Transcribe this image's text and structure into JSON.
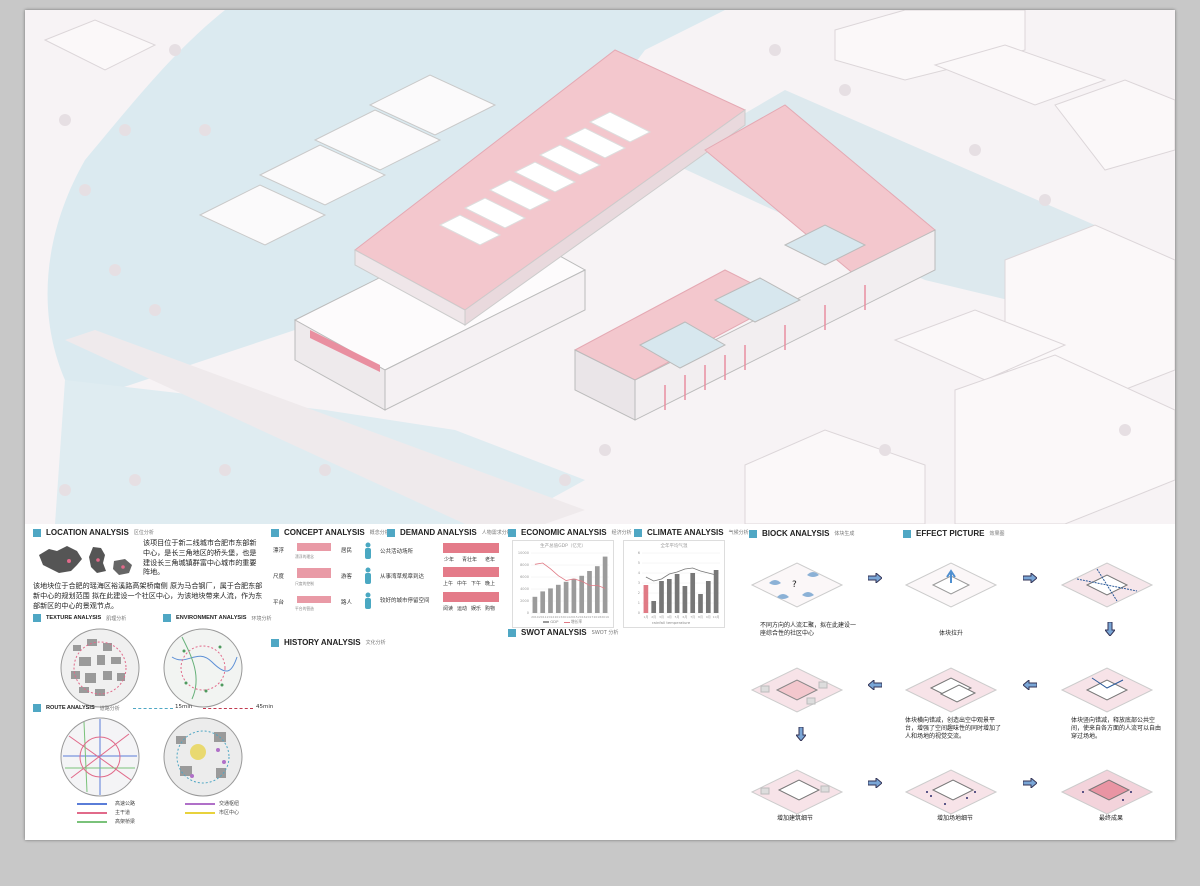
{
  "hero": {
    "palette": {
      "water": "#d7e8ee",
      "roof": "#f1c6cc",
      "roof_edge": "#e7a5b0",
      "ground": "#f8f2f4",
      "building": "#fbf8f9"
    }
  },
  "location": {
    "title": "LOCATION ANALYSIS",
    "title_cn": "区位分析",
    "paragraph_1": "该项目位于新二线城市合肥市东部新中心，是长三角地区的桥头堡，也是建设长三角城镇群富中心城市的重要阵地。",
    "paragraph_2": "该地块位于合肥的瑶海区裕溪路高架桥南侧 原为马合钢厂，属于合肥东部新中心的规划范围 拟在此建设一个社区中心，为该地块带来人流，作为东部新区的中心的景观节点。"
  },
  "texture": {
    "title": "TEXTURE ANALYSIS",
    "title_cn": "肌理分析"
  },
  "environment": {
    "title": "ENVIRONMENT ANALYSIS",
    "title_cn": "环境分析"
  },
  "route": {
    "title": "ROUTE ANALYSIS",
    "title_cn": "道路分析",
    "time_15": "15min",
    "time_45": "45min",
    "legend": [
      {
        "label": "高速公路",
        "color": "#5a7dd8"
      },
      {
        "label": "主干道",
        "color": "#e16a8a"
      },
      {
        "label": "高架桥梁",
        "color": "#7ac27a"
      },
      {
        "label": "交通枢纽",
        "color": "#b070c8"
      },
      {
        "label": "市区中心",
        "color": "#e8d23c"
      }
    ]
  },
  "concept": {
    "title": "CONCEPT ANALYSIS",
    "title_cn": "概念分析",
    "rows": [
      {
        "label": "漂浮",
        "caption": "漂浮的理念",
        "role": "居民"
      },
      {
        "label": "尺度",
        "caption": "尺度的控制",
        "role": "游客"
      },
      {
        "label": "平台",
        "caption": "平台的营造",
        "role": "路人"
      }
    ]
  },
  "history": {
    "title": "HISTORY ANALYSIS",
    "title_cn": "文化分析"
  },
  "demand": {
    "title": "DEMAND ANALYSIS",
    "title_cn": "人物需求分析",
    "items": [
      {
        "text": "公共活动场所",
        "tags": [
          "少年",
          "青壮年",
          "老年"
        ]
      },
      {
        "text": "从事湾草规章到达",
        "tags": [
          "上午",
          "中午",
          "下午",
          "晚上"
        ]
      },
      {
        "text": "较好的城市停留空间",
        "tags": [
          "阅读",
          "运动",
          "娱乐",
          "购物"
        ]
      }
    ]
  },
  "economic": {
    "title": "ECONOMIC ANALYSIS",
    "title_cn": "经济分析",
    "chart_title": "生产总值GDP（亿元）",
    "legend_bar": "GDP",
    "legend_line": "增长率"
  },
  "climate": {
    "title": "CLIMATE ANALYSIS",
    "title_cn": "气候分析",
    "chart_title": "全年平均气温",
    "legend": "rainfall  temperature"
  },
  "swot": {
    "title": "SWOT ANALYSIS",
    "title_cn": "SWOT 分析"
  },
  "block": {
    "title": "BlOCK ANALYSIS",
    "title_cn": "体块生成"
  },
  "effect": {
    "title": "EFFECT PICTURE",
    "title_cn": "效果图"
  },
  "steps": {
    "s1": "不同方向的人流汇聚，拟在此建设一座综合性的社区中心",
    "s2": "体块拉升",
    "s3": "体块竖向错减，释放底部公共空间，使来自各方面的人流可以自由穿过场地。",
    "s4": "体块横向错减，创造出空中观景平台，增强了空间趣味性的同时增加了人和场地的视觉交流。",
    "s5": "增加建筑细节",
    "s6": "增加场地细节",
    "s7": "最终成果"
  },
  "chart_data": [
    {
      "type": "bar",
      "title": "生产总值GDP（亿元）",
      "categories": [
        "2010",
        "2011",
        "2012",
        "2013",
        "2014",
        "2015",
        "2016",
        "2017",
        "2018",
        "2019"
      ],
      "series": [
        {
          "name": "GDP",
          "values": [
            2700,
            3600,
            4100,
            4700,
            5200,
            5700,
            6200,
            7000,
            7800,
            9400
          ]
        },
        {
          "name": "增长率",
          "values": [
            15,
            15.4,
            13.6,
            11.5,
            10,
            10.5,
            9.8,
            8.5,
            8.5,
            7.6
          ]
        }
      ],
      "ylim": [
        0,
        10000
      ],
      "colors": [
        "#9b9b9b",
        "#e07a85"
      ]
    },
    {
      "type": "bar",
      "title": "全年平均气温",
      "categories": [
        "1月",
        "2月",
        "3月",
        "4月",
        "5月",
        "6月",
        "7月",
        "8月",
        "9月",
        "10月"
      ],
      "series": [
        {
          "name": "rainfall",
          "values": [
            2.8,
            1.2,
            3.2,
            3.4,
            3.9,
            2.7,
            4.0,
            1.9,
            3.2,
            4.3
          ]
        },
        {
          "name": "temperature",
          "values": [
            3.6,
            3.2,
            3.4,
            3.9,
            4.1,
            4.4,
            4.5,
            4.2,
            4.0,
            3.8
          ]
        }
      ],
      "ylim": [
        0,
        6
      ],
      "colors": [
        "#e07a85",
        "#777777"
      ]
    }
  ]
}
